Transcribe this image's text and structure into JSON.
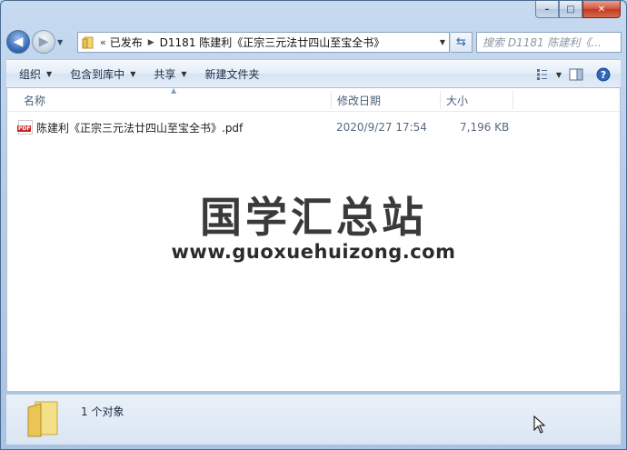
{
  "window": {
    "caption": {
      "minimize": "–",
      "maximize": "□",
      "close": "✕"
    }
  },
  "nav": {
    "back_icon": "back-arrow-icon",
    "forward_icon": "forward-arrow-icon",
    "address": {
      "overflow": "«",
      "segments": [
        "已发布",
        "D1181 陈建利《正宗三元法廿四山至宝全书》"
      ],
      "separator": "▶"
    },
    "search_placeholder": "搜索 D1181 陈建利《..."
  },
  "toolbar": {
    "organize": "组织",
    "include_in_library": "包含到库中",
    "share": "共享",
    "new_folder": "新建文件夹"
  },
  "columns": {
    "name": "名称",
    "modified": "修改日期",
    "size": "大小"
  },
  "files": [
    {
      "name": "陈建利《正宗三元法廿四山至宝全书》.pdf",
      "modified": "2020/9/27 17:54",
      "size": "7,196 KB",
      "icon": "pdf-file-icon"
    }
  ],
  "watermark": {
    "title": "国学汇总站",
    "url": "www.guoxuehuizong.com"
  },
  "status": {
    "count": "1 个对象"
  },
  "colors": {
    "accent": "#3a6fb9",
    "window_frame": "#b7cde8",
    "close": "#c03a1f",
    "pdf_red": "#c62828"
  }
}
